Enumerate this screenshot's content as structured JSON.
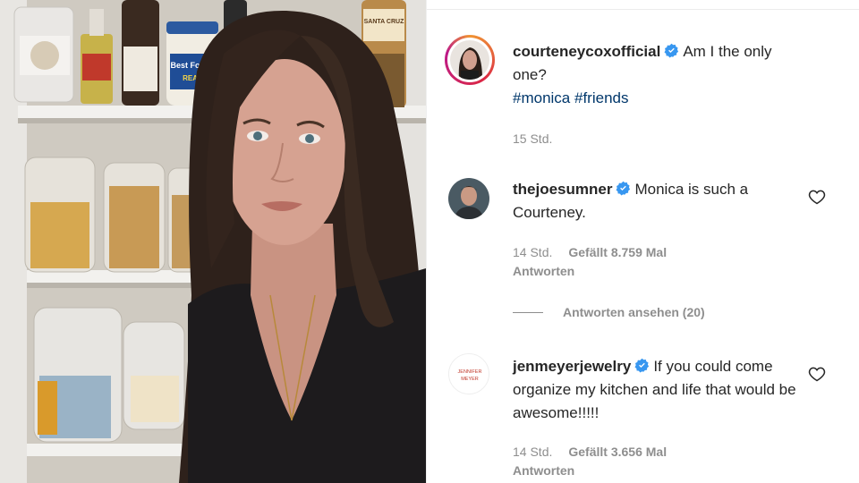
{
  "post": {
    "author": "courteneycoxofficial",
    "caption": "Am I the only one?",
    "hashtags": [
      "#monica",
      "#friends"
    ],
    "time": "15 Std.",
    "media_labels": {
      "jar_top_left": "",
      "bottle_red_label": "",
      "mayo_brand": "Best Foods",
      "mayo_sub": "REAL",
      "jar_top_right": "SANTA CRUZ"
    }
  },
  "comments": [
    {
      "user": "thejoesumner",
      "verified": true,
      "text": "Monica is such a Courteney.",
      "time": "14 Std.",
      "likes": "Gefällt 8.759 Mal",
      "reply_label": "Antworten",
      "view_replies": "Antworten ansehen (20)"
    },
    {
      "user": "jenmeyerjewelry",
      "verified": true,
      "avatar_text": "JENNIFER MEYER",
      "text": "If you could come organize my kitchen and life that would be awesome!!!!!",
      "time": "14 Std.",
      "likes": "Gefällt 3.656 Mal",
      "reply_label": "Antworten"
    }
  ],
  "colors": {
    "verified_blue": "#3897f0",
    "hashtag": "#00376b",
    "muted": "#8e8e8e"
  },
  "icons": {
    "verified": "verified-badge-icon",
    "like": "heart-outline-icon"
  }
}
